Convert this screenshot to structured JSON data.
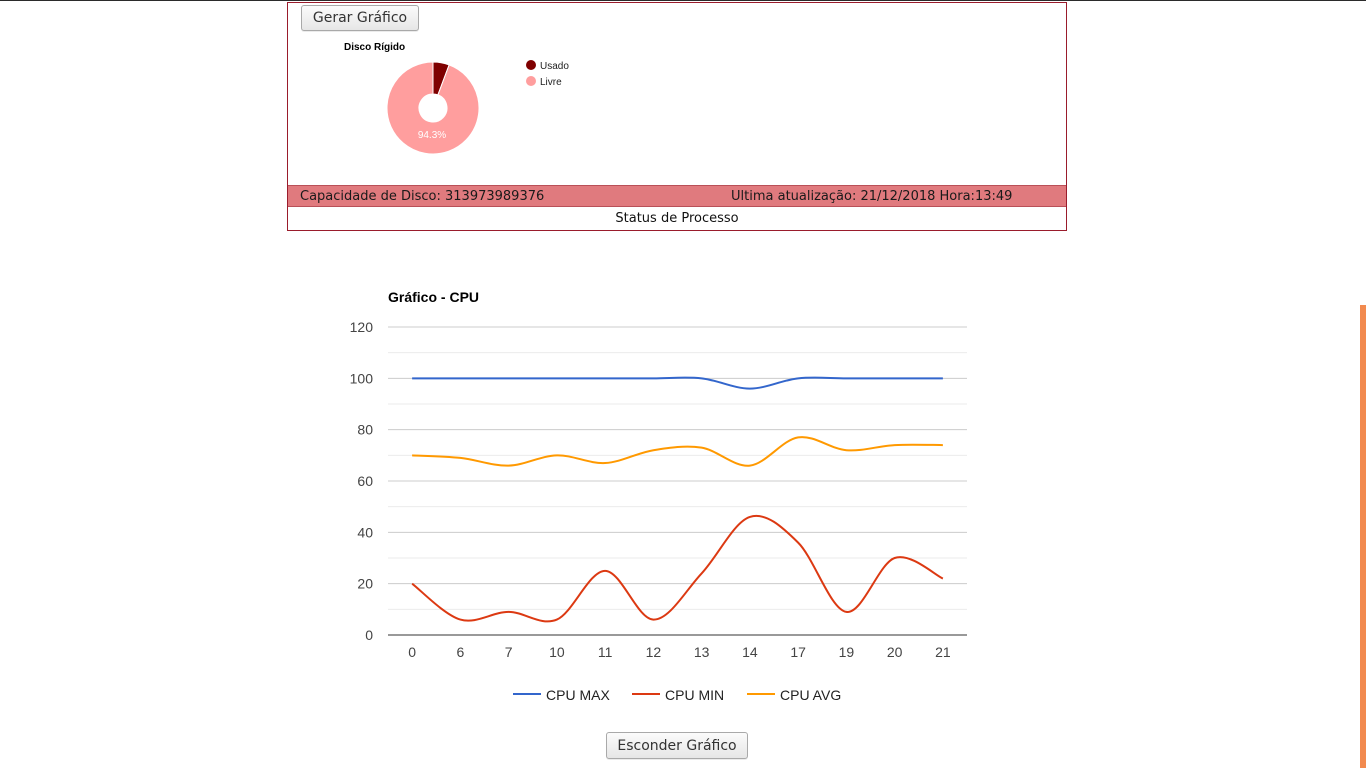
{
  "disk_panel": {
    "generate_button": "Gerar Gráfico",
    "pie_chart": {
      "type": "pie",
      "title": "Disco Rígido",
      "slices": [
        {
          "label": "Usado",
          "value": 5.7,
          "color": "#7f0000"
        },
        {
          "label": "Livre",
          "value": 94.3,
          "color": "#ff9e9e"
        }
      ],
      "slice_label": "94.3%",
      "donut": true
    },
    "capacity_text": "Capacidade de Disco: 313973989376",
    "last_update_text": "Ultima atualização: 21/12/2018 Hora:13:49",
    "process_status": "Status de Processo"
  },
  "chart_data": {
    "type": "line",
    "title": "Gráfico - CPU",
    "categories": [
      "0",
      "6",
      "7",
      "10",
      "11",
      "12",
      "13",
      "14",
      "17",
      "19",
      "20",
      "21"
    ],
    "ylim": [
      0,
      120
    ],
    "yticks": [
      "0",
      "20",
      "40",
      "60",
      "80",
      "100",
      "120"
    ],
    "grid": true,
    "legend": "bottom",
    "series": [
      {
        "name": "CPU MAX",
        "color": "#3366cc",
        "values": [
          100,
          100,
          100,
          100,
          100,
          100,
          100,
          96,
          100,
          100,
          100,
          100
        ]
      },
      {
        "name": "CPU MIN",
        "color": "#dc3912",
        "values": [
          20,
          6,
          9,
          6,
          25,
          6,
          24,
          46,
          36,
          9,
          30,
          22
        ]
      },
      {
        "name": "CPU AVG",
        "color": "#ff9900",
        "values": [
          70,
          69,
          66,
          70,
          67,
          72,
          73,
          66,
          77,
          72,
          74,
          74
        ]
      }
    ]
  },
  "hide_button": "Esconder Gráfico"
}
